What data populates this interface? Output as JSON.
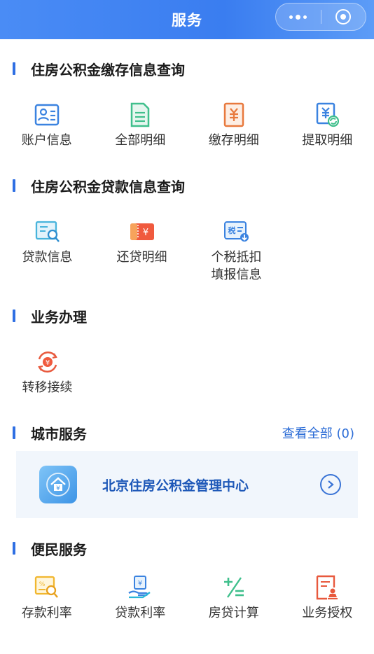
{
  "topbar": {
    "title": "服务"
  },
  "deposit_section": {
    "title": "住房公积金缴存信息查询",
    "items": [
      {
        "label": "账户信息",
        "icon": "account-card-icon"
      },
      {
        "label": "全部明细",
        "icon": "document-list-icon"
      },
      {
        "label": "缴存明细",
        "icon": "yuan-bill-icon"
      },
      {
        "label": "提取明细",
        "icon": "yuan-refresh-icon"
      }
    ]
  },
  "loan_section": {
    "title": "住房公积金贷款信息查询",
    "items": [
      {
        "label": "贷款信息",
        "icon": "loan-search-icon"
      },
      {
        "label": "还贷明细",
        "icon": "yuan-ticket-icon"
      },
      {
        "label": "个税抵扣填报信息",
        "icon": "tax-download-icon",
        "badge": "税"
      }
    ]
  },
  "business_section": {
    "title": "业务办理",
    "items": [
      {
        "label": "转移接续",
        "icon": "transfer-yuan-icon"
      }
    ]
  },
  "city_section": {
    "title": "城市服务",
    "view_all": "查看全部 (0)",
    "card": {
      "name": "北京住房公积金管理中心",
      "logo": "house-fund-logo-icon"
    }
  },
  "convenience_section": {
    "title": "便民服务",
    "items": [
      {
        "label": "存款利率",
        "icon": "deposit-rate-icon"
      },
      {
        "label": "贷款利率",
        "icon": "loan-rate-icon"
      },
      {
        "label": "房贷计算",
        "icon": "calculator-icon"
      },
      {
        "label": "业务授权",
        "icon": "authorization-icon"
      }
    ]
  },
  "colors": {
    "topbar": "#3a7df0",
    "accent": "#2f6fe3",
    "link": "#2a6bd6",
    "card_bg": "#f1f6fc"
  }
}
